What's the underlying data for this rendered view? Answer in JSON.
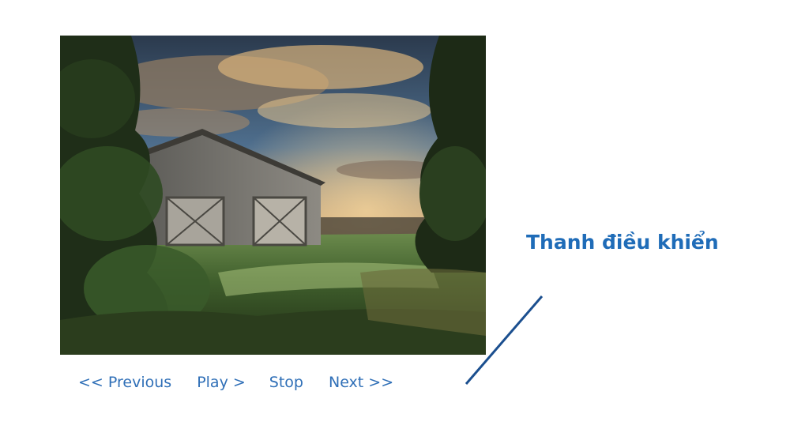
{
  "slideshow": {
    "image": {
      "alt": "barn-at-sunset"
    },
    "controls": {
      "previous_label": "<< Previous",
      "play_label": "Play >",
      "stop_label": "Stop",
      "next_label": "Next >>"
    }
  },
  "annotation": {
    "label": "Thanh điều khiển",
    "color": "#1f6cb8"
  },
  "colors": {
    "control_link": "#2f6fb7"
  }
}
